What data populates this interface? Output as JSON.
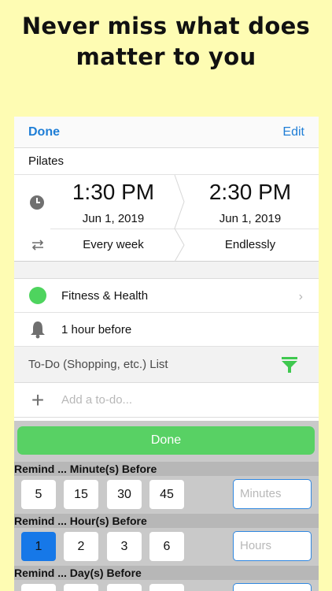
{
  "headline": {
    "line1": "Never miss what does",
    "line2": "matter to you"
  },
  "nav": {
    "done": "Done",
    "edit": "Edit"
  },
  "event": {
    "title": "Pilates",
    "start_time": "1:30 PM",
    "start_date": "Jun 1, 2019",
    "end_time": "2:30 PM",
    "end_date": "Jun 1, 2019",
    "repeat": "Every week",
    "repeat_end": "Endlessly",
    "category": "Fitness & Health",
    "category_color": "#4ed45e",
    "alert": "1 hour before"
  },
  "todo": {
    "header": "To-Do (Shopping, etc.) List",
    "add_placeholder": "Add a to-do..."
  },
  "picker": {
    "done": "Done",
    "minutes": {
      "label": "Remind ... Minute(s) Before",
      "options": [
        "5",
        "15",
        "30",
        "45"
      ],
      "placeholder": "Minutes"
    },
    "hours": {
      "label": "Remind ... Hour(s) Before",
      "options": [
        "1",
        "2",
        "3",
        "6"
      ],
      "placeholder": "Hours",
      "selected": "1"
    },
    "days": {
      "label": "Remind ... Day(s) Before"
    }
  },
  "colors": {
    "accent": "#1f7ed6",
    "green": "#58d164",
    "selected": "#1678e8",
    "background": "#fefcb3"
  }
}
